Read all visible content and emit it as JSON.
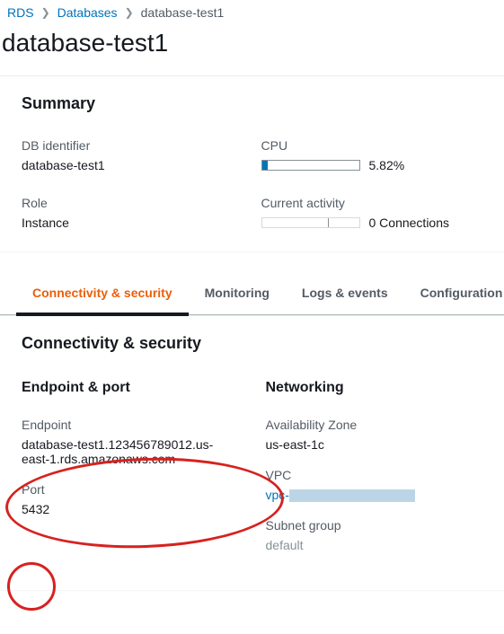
{
  "breadcrumb": {
    "root": "RDS",
    "databases": "Databases",
    "current": "database-test1"
  },
  "page_title": "database-test1",
  "summary": {
    "heading": "Summary",
    "db_identifier_label": "DB identifier",
    "db_identifier_value": "database-test1",
    "cpu_label": "CPU",
    "cpu_value": "5.82%",
    "role_label": "Role",
    "role_value": "Instance",
    "activity_label": "Current activity",
    "activity_value": "0 Connections"
  },
  "tabs": {
    "connectivity": "Connectivity & security",
    "monitoring": "Monitoring",
    "logs": "Logs & events",
    "configuration": "Configuration"
  },
  "conn": {
    "heading": "Connectivity & security",
    "endpoint_port_heading": "Endpoint & port",
    "endpoint_label": "Endpoint",
    "endpoint_value": "database-test1.123456789012.us-east-1.rds.amazonaws.com",
    "port_label": "Port",
    "port_value": "5432",
    "networking_heading": "Networking",
    "az_label": "Availability Zone",
    "az_value": "us-east-1c",
    "vpc_label": "VPC",
    "vpc_link_prefix": "vpc-",
    "subnet_label": "Subnet group",
    "subnet_value": "default"
  }
}
